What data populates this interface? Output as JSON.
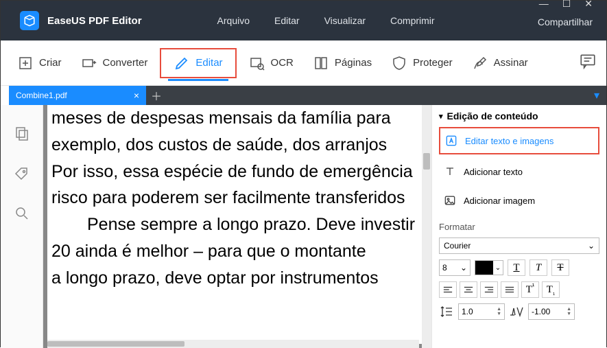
{
  "app": {
    "name": "EaseUS PDF Editor"
  },
  "menu": {
    "arquivo": "Arquivo",
    "editar": "Editar",
    "visualizar": "Visualizar",
    "comprimir": "Comprimir",
    "compartilhar": "Compartilhar"
  },
  "toolbar": {
    "criar": "Criar",
    "converter": "Converter",
    "editar": "Editar",
    "ocr": "OCR",
    "paginas": "Páginas",
    "proteger": "Proteger",
    "assinar": "Assinar"
  },
  "tabs": {
    "current": "Combine1.pdf"
  },
  "doc_lines": [
    "meses de despesas mensais da família para",
    "exemplo, dos custos de saúde, dos arranjos",
    "Por isso, essa espécie de fundo de emergência",
    "risco para poderem ser facilmente transferidos",
    "Pense sempre a longo prazo. Deve investir",
    "20 ainda é melhor – para que o montante",
    "a longo prazo, deve optar por instrumentos"
  ],
  "panel": {
    "title": "Edição de conteúdo",
    "edit_text_images": "Editar texto e imagens",
    "add_text": "Adicionar texto",
    "add_image": "Adicionar imagem",
    "formatar": "Formatar",
    "font": "Courier",
    "font_size": "8",
    "line_spacing": "1.0",
    "char_spacing": "-1.00"
  }
}
